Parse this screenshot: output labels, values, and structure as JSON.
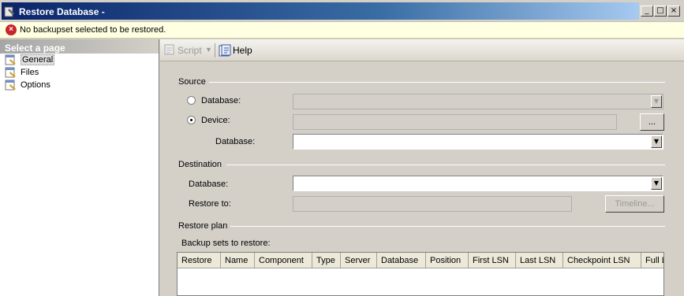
{
  "window": {
    "title": "Restore Database -",
    "minimize_glyph": "_",
    "maximize_glyph": "□",
    "close_glyph": "×"
  },
  "error": {
    "icon_glyph": "×",
    "message": "No backupset selected to be restored."
  },
  "left_pane": {
    "header": "Select a page",
    "pages": [
      {
        "label": "General",
        "icon": "page-wrench-icon"
      },
      {
        "label": "Files",
        "icon": "page-wrench-icon"
      },
      {
        "label": "Options",
        "icon": "page-wrench-icon"
      }
    ]
  },
  "toolbar": {
    "script_label": "Script",
    "script_dropdown_glyph": "▼",
    "help_label": "Help"
  },
  "source": {
    "title": "Source",
    "database_radio_label": "Database:",
    "device_radio_label": "Device:",
    "device_database_label": "Database:",
    "browse_label": "...",
    "selected": "device"
  },
  "destination": {
    "title": "Destination",
    "database_label": "Database:",
    "restore_to_label": "Restore to:",
    "timeline_label": "Timeline..."
  },
  "restore_plan": {
    "title": "Restore plan",
    "backup_sets_label": "Backup sets to restore:",
    "columns": [
      "Restore",
      "Name",
      "Component",
      "Type",
      "Server",
      "Database",
      "Position",
      "First LSN",
      "Last LSN",
      "Checkpoint LSN",
      "Full L"
    ]
  },
  "combo_arrow_glyph": "▼"
}
